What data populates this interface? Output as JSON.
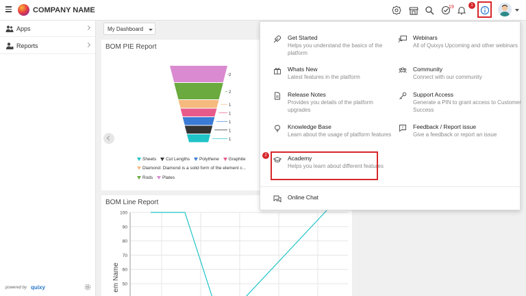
{
  "header": {
    "company_name": "COMPANY NAME",
    "notification_count": "19",
    "step1": "1",
    "icons": [
      "menu-icon",
      "settings-icon",
      "store-icon",
      "search-icon",
      "task-check-icon",
      "bell-icon",
      "info-icon"
    ]
  },
  "sidebar": {
    "items": [
      {
        "label": "Apps",
        "icon": "apps-users-icon"
      },
      {
        "label": "Reports",
        "icon": "reports-user-icon"
      }
    ],
    "powered_by": "powered by",
    "brand": "quixy"
  },
  "main": {
    "dashboard_select": "My Dashboard",
    "pie_card": {
      "title": "BOM PIE Report",
      "legend": [
        {
          "label": "Sheets",
          "color": "#1fc3c8"
        },
        {
          "label": "Cut Lengths",
          "color": "#333333"
        },
        {
          "label": "Polythene",
          "color": "#3a7bd5"
        },
        {
          "label": "Graphite",
          "color": "#e75b8a"
        },
        {
          "label": "Diamond: Diamond is a solid form of the element c...",
          "color": "#f6b97e"
        },
        {
          "label": "Rods",
          "color": "#6aaa3e"
        },
        {
          "label": "Plates",
          "color": "#d98ad0"
        }
      ]
    },
    "line_card": {
      "title": "BOM Line Report",
      "y_ticks": [
        "100",
        "90",
        "80",
        "70",
        "60",
        "50",
        "40"
      ],
      "y_label": "em Name"
    }
  },
  "chart_data": {
    "type": "bar",
    "title": "BOM PIE Report",
    "categories": [
      "Plates",
      "Rods",
      "Diamond: Diamond is a solid form of the element c...",
      "Graphite",
      "Polythene",
      "Cut Lengths",
      "Sheets"
    ],
    "values": [
      2,
      2,
      1,
      1,
      1,
      1,
      1
    ],
    "colors": [
      "#d98ad0",
      "#6aaa3e",
      "#f6b97e",
      "#e75b8a",
      "#3a7bd5",
      "#333333",
      "#1fc3c8"
    ]
  },
  "help_menu": {
    "left": [
      {
        "title": "Get Started",
        "desc": "Helps you understand the basics of the platform",
        "icon": "rocket-icon"
      },
      {
        "title": "Whats New",
        "desc": "Latest features in the platform",
        "icon": "gift-icon"
      },
      {
        "title": "Release Notes",
        "desc": "Provides you details of the platform upgrades",
        "icon": "document-icon"
      },
      {
        "title": "Knowledge Base",
        "desc": "Learn about the usage of platform features",
        "icon": "lightbulb-icon"
      },
      {
        "title": "Academy",
        "desc": "Helps you learn about different features",
        "icon": "graduation-cap-icon"
      }
    ],
    "right": [
      {
        "title": "Webinars",
        "desc": "All of Quixys Upcoming and other webinars",
        "icon": "presentation-icon"
      },
      {
        "title": "Community",
        "desc": "Connect with our community",
        "icon": "community-icon"
      },
      {
        "title": "Support Access",
        "desc": "Generate a PIN to grant access to Customer Success",
        "icon": "key-icon"
      },
      {
        "title": "Feedback / Report issue",
        "desc": "Give a feedback or report an issue",
        "icon": "feedback-icon"
      }
    ],
    "chat": {
      "title": "Online Chat",
      "icon": "chat-icon"
    },
    "step2": "2"
  },
  "colors": {
    "accent_red": "#d7262a",
    "line": "#1fc3c8",
    "brand_blue": "#2677c9"
  }
}
